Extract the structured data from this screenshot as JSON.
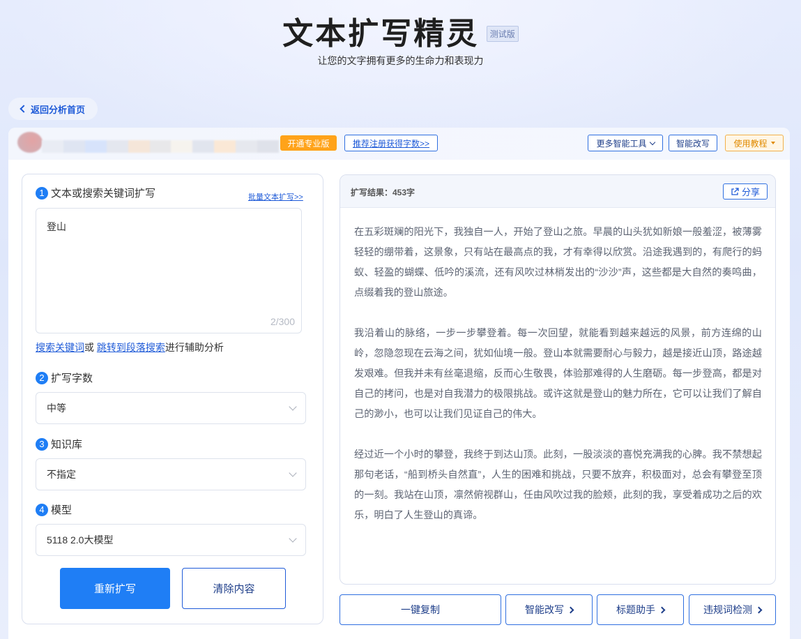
{
  "header": {
    "title": "文本扩写精灵",
    "badge": "测试版",
    "subtitle": "让您的文字拥有更多的生命力和表现力"
  },
  "nav": {
    "back_label": "返回分析首页"
  },
  "topbar": {
    "pro_label": "开通专业版",
    "referral_label": "推荐注册获得字数>>",
    "tools_label": "更多智能工具",
    "rewrite_label": "智能改写",
    "tutorial_label": "使用教程"
  },
  "form": {
    "step1": {
      "num": "1",
      "label": "文本或搜索关键词扩写",
      "batch_link": "批量文本扩写>>"
    },
    "input": {
      "value": "登山",
      "count": "2/300"
    },
    "helper": {
      "link1": "搜索关键词",
      "mid": "或",
      "link2": "跳转到段落搜索",
      "suffix": "进行辅助分析"
    },
    "step2": {
      "num": "2",
      "label": "扩写字数",
      "value": "中等"
    },
    "step3": {
      "num": "3",
      "label": "知识库",
      "value": "不指定"
    },
    "step4": {
      "num": "4",
      "label": "模型",
      "value": "5118 2.0大模型"
    },
    "rewrite_button": "重新扩写",
    "clear_button": "清除内容"
  },
  "result": {
    "label": "扩写结果：453字",
    "share_label": "分享",
    "paragraphs": [
      "在五彩斑斓的阳光下，我独自一人，开始了登山之旅。早晨的山头犹如新娘一般羞涩，被薄雾轻轻的绷带着，这景象，只有站在最高点的我，才有幸得以欣赏。沿途我遇到的，有爬行的蚂蚁、轻盈的蝴蝶、低吟的溪流，还有风吹过林梢发出的“沙沙”声，这些都是大自然的奏鸣曲，点缀着我的登山旅途。",
      "我沿着山的脉络，一步一步攀登着。每一次回望，就能看到越来越远的风景，前方连绵的山岭，忽隐忽现在云海之间，犹如仙境一般。登山本就需要耐心与毅力，越是接近山顶，路途越发艰难。但我并未有丝毫退缩，反而心生敬畏，体验那难得的人生磨砺。每一步登高，都是对自己的拷问，也是对自我潜力的极限挑战。或许这就是登山的魅力所在，它可以让我们了解自己的渺小，也可以让我们见证自己的伟大。",
      "经过近一个小时的攀登，我终于到达山顶。此刻，一股淡淡的喜悦充满我的心脾。我不禁想起那句老话，“船到桥头自然直”，人生的困难和挑战，只要不放弃，积极面对，总会有攀登至顶的一刻。我站在山顶，凛然俯视群山，任由风吹过我的脸颊，此刻的我，享受着成功之后的欢乐，明白了人生登山的真谛。"
    ]
  },
  "actions": {
    "copy": "一键复制",
    "rewrite": "智能改写",
    "title_helper": "标题助手",
    "violation_check": "违规词检测"
  }
}
